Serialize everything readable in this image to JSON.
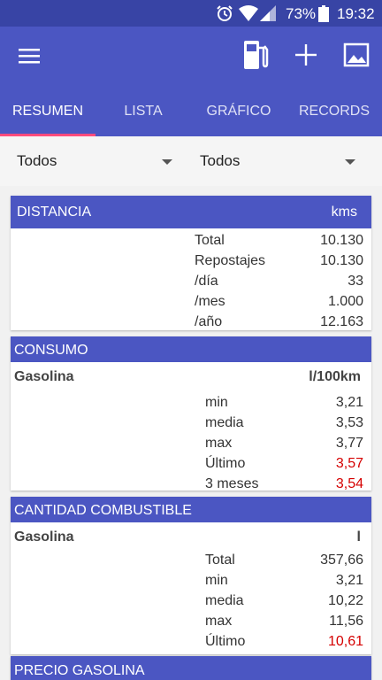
{
  "status_bar": {
    "battery": "73%",
    "time": "19:32",
    "icons": [
      "alarm-icon",
      "wifi-icon",
      "signal-icon",
      "battery-icon"
    ]
  },
  "app_bar": {
    "icons": [
      "menu-icon",
      "fuel-pump-icon",
      "add-icon",
      "image-icon"
    ]
  },
  "tabs": [
    {
      "label": "RESUMEN"
    },
    {
      "label": "LISTA"
    },
    {
      "label": "GRÁFICO"
    },
    {
      "label": "RECORDS"
    }
  ],
  "filters": [
    {
      "selected": "Todos"
    },
    {
      "selected": "Todos"
    }
  ],
  "distancia": {
    "title": "DISTANCIA",
    "unit": "kms",
    "rows": [
      {
        "label": "Total",
        "value": "10.130"
      },
      {
        "label": "Repostajes",
        "value": "10.130"
      },
      {
        "label": "/día",
        "value": "33"
      },
      {
        "label": "/mes",
        "value": "1.000"
      },
      {
        "label": "/año",
        "value": "12.163"
      }
    ]
  },
  "consumo": {
    "title": "CONSUMO",
    "fuel": "Gasolina",
    "unit": "l/100km",
    "rows": [
      {
        "label": "min",
        "value": "3,21"
      },
      {
        "label": "media",
        "value": "3,53"
      },
      {
        "label": "max",
        "value": "3,77"
      },
      {
        "label": "Último",
        "value": "3,57"
      },
      {
        "label": "3 meses",
        "value": "3,54"
      }
    ]
  },
  "cantidad": {
    "title": "CANTIDAD COMBUSTIBLE",
    "fuel": "Gasolina",
    "unit": "l",
    "rows": [
      {
        "label": "Total",
        "value": "357,66"
      },
      {
        "label": "min",
        "value": "3,21"
      },
      {
        "label": "media",
        "value": "10,22"
      },
      {
        "label": "max",
        "value": "11,56"
      },
      {
        "label": "Último",
        "value": "10,61"
      }
    ]
  },
  "precio": {
    "title": "PRECIO GASOLINA"
  },
  "colors": {
    "status_bar": "#3844a5",
    "primary": "#4b56c2",
    "tab_indicator": "#ff4b7d",
    "highlight_value": "#d50000"
  }
}
